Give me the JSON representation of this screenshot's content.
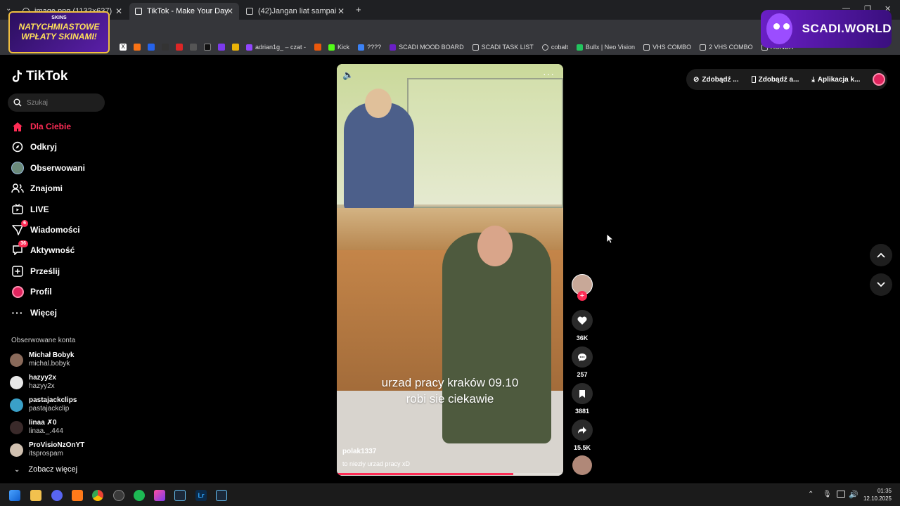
{
  "browser": {
    "tabs": [
      {
        "title": "image.png (1132×637)",
        "active": false
      },
      {
        "title": "TikTok - Make Your Day",
        "active": true
      },
      {
        "title": "(42)Jangan liat sampai akhir ad",
        "active": false
      }
    ],
    "new_tab_symbol": "+",
    "bookmarks": [
      {
        "label": "adrian1g_ – czat -",
        "color": "#9146ff"
      },
      {
        "label": "Kick",
        "color": "#53fc18"
      },
      {
        "label": "????",
        "color": "#3b82f6"
      },
      {
        "label": "SCADI MOOD BOARD",
        "color": "#6a1fc6"
      },
      {
        "label": "SCADI TASK LIST",
        "color": "#cccccc"
      },
      {
        "label": "cobalt",
        "color": "#cccccc"
      },
      {
        "label": "Bullx | Neo Vision",
        "color": "#22c55e"
      },
      {
        "label": "VHS COMBO",
        "color": "#cccccc"
      },
      {
        "label": "2 VHS COMBO",
        "color": "#cccccc"
      },
      {
        "label": "HONDA",
        "color": "#cccccc"
      }
    ]
  },
  "ads": {
    "left_top": "SKINS",
    "left_main": "NATYCHMIASTOWE WPŁATY SKINAMI!",
    "right": "SCADI.WORLD"
  },
  "sidebar": {
    "logo": "TikTok",
    "search_placeholder": "Szukaj",
    "nav": [
      {
        "label": "Dla Ciebie",
        "icon": "home-icon",
        "active": true
      },
      {
        "label": "Odkryj",
        "icon": "compass-icon"
      },
      {
        "label": "Obserwowani",
        "icon": "avatar-icon"
      },
      {
        "label": "Znajomi",
        "icon": "friends-icon"
      },
      {
        "label": "LIVE",
        "icon": "live-icon"
      },
      {
        "label": "Wiadomości",
        "icon": "messages-icon",
        "badge": "6"
      },
      {
        "label": "Aktywność",
        "icon": "activity-icon",
        "badge": "36"
      },
      {
        "label": "Prześlij",
        "icon": "upload-icon"
      },
      {
        "label": "Profil",
        "icon": "profile-icon"
      },
      {
        "label": "Więcej",
        "icon": "more-icon"
      }
    ],
    "following_title": "Obserwowane konta",
    "accounts": [
      {
        "name": "Michał Bobyk",
        "handle": "michal.bobyk",
        "color": "#8a6a5a"
      },
      {
        "name": "hazyy2x",
        "handle": "hazyy2x",
        "color": "#e8e8e8"
      },
      {
        "name": "pastajackclips",
        "handle": "pastajackclip",
        "color": "#3aa0c8"
      },
      {
        "name": "linaa ✗0",
        "handle": "linaa._.444",
        "color": "#3a2a2a"
      },
      {
        "name": "ProVisioNzOnYT",
        "handle": "itsprospam",
        "color": "#d0c0b0"
      }
    ],
    "see_more": "Zobacz więcej"
  },
  "video": {
    "caption_line1": "urzad pracy kraków 09.10",
    "caption_line2": "robi sie ciekawie",
    "author": "polak1337",
    "description": "to niezły urzad pracy xD",
    "progress": 0.78
  },
  "actions": {
    "likes": "36K",
    "comments": "257",
    "saves": "3881",
    "shares": "15.5K"
  },
  "topright": {
    "item1": "Zdobądź ...",
    "item2": "Zdobądź a...",
    "item3": "Aplikacja k..."
  },
  "taskbar": {
    "time": "01:35",
    "date": "12.10.2025"
  },
  "colors": {
    "accent": "#fe2c55"
  }
}
